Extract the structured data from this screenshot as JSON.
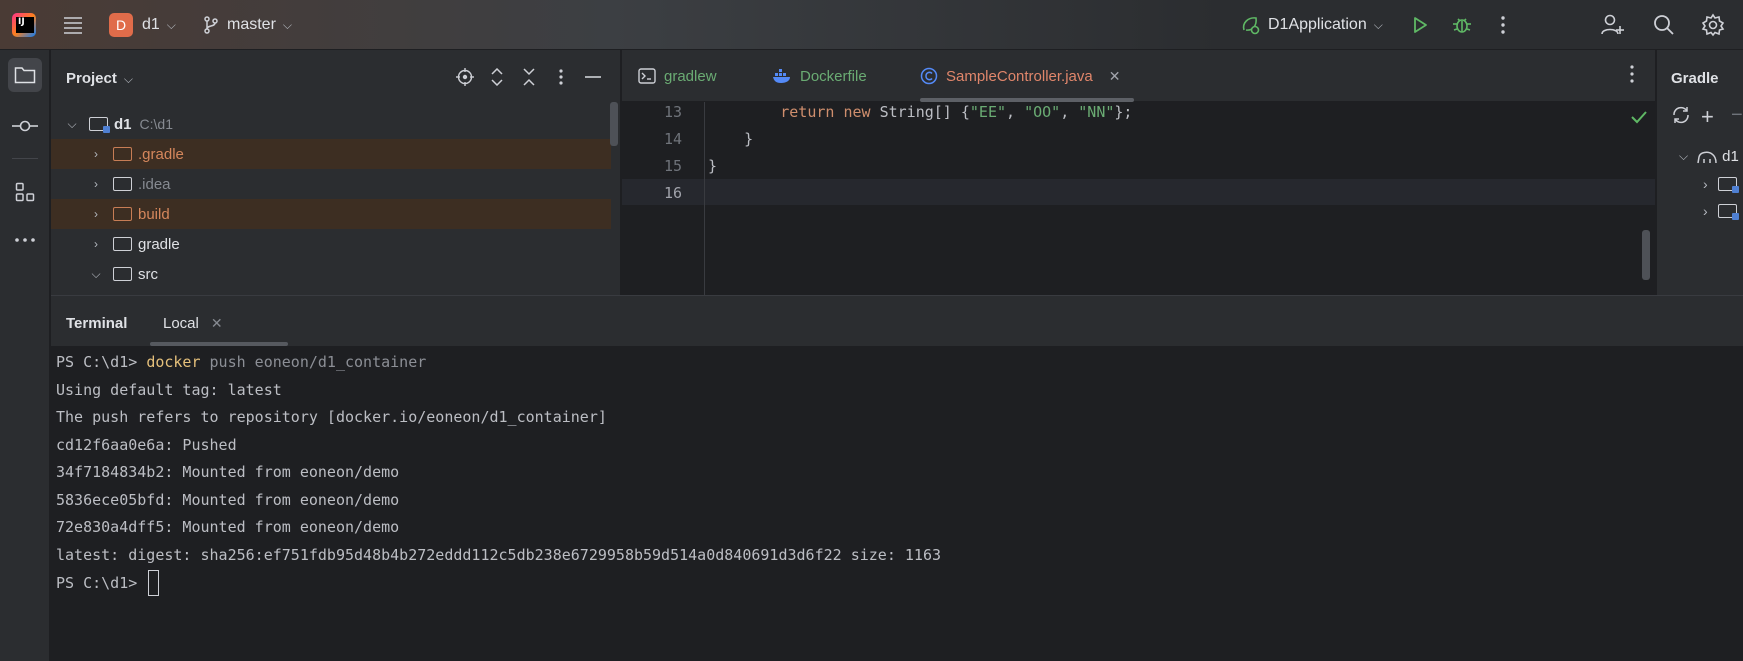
{
  "titlebar": {
    "project_badge": "D",
    "project_name": "d1",
    "branch": "master",
    "run_config": "D1Application"
  },
  "project_panel": {
    "title": "Project",
    "tree": [
      {
        "label": "d1",
        "path": "C:\\d1",
        "expanded": true
      },
      {
        "label": ".gradle",
        "excluded": true
      },
      {
        "label": ".idea"
      },
      {
        "label": "build",
        "excluded": true
      },
      {
        "label": "gradle"
      },
      {
        "label": "src",
        "expanded": true
      }
    ]
  },
  "editor": {
    "tabs": [
      {
        "label": "gradlew",
        "icon": "terminal-file-icon"
      },
      {
        "label": "Dockerfile",
        "icon": "docker-icon"
      },
      {
        "label": "SampleController.java",
        "icon": "java-class-icon",
        "active": true
      }
    ],
    "lines": [
      {
        "no": "13",
        "parts": [
          [
            "",
            "        "
          ],
          [
            "kw",
            "return new "
          ],
          [
            "",
            "String[] {"
          ],
          [
            "str",
            "\"EE\""
          ],
          [
            "",
            ", "
          ],
          [
            "str",
            "\"OO\""
          ],
          [
            "",
            ", "
          ],
          [
            "str",
            "\"NN\""
          ],
          [
            "",
            "};"
          ]
        ]
      },
      {
        "no": "14",
        "parts": [
          [
            "",
            "    }"
          ]
        ]
      },
      {
        "no": "15",
        "parts": [
          [
            "",
            "}"
          ]
        ]
      },
      {
        "no": "16",
        "parts": [
          [
            "",
            ""
          ]
        ]
      }
    ]
  },
  "gradle_panel": {
    "title": "Gradle",
    "root": "d1"
  },
  "terminal": {
    "title": "Terminal",
    "tab": "Local",
    "prompt": "PS C:\\d1> ",
    "command": "docker",
    "command_args": " push eoneon/d1_container",
    "output": [
      "Using default tag: latest",
      "The push refers to repository [docker.io/eoneon/d1_container]",
      "cd12f6aa0e6a: Pushed",
      "34f7184834b2: Mounted from eoneon/demo",
      "5836ece05bfd: Mounted from eoneon/demo",
      "72e830a4dff5: Mounted from eoneon/demo",
      "latest: digest: sha256:ef751fdb95d48b4b272eddd112c5db238e6729958b59d514a0d840691d3d6f22 size: 1163"
    ],
    "final_prompt": "PS C:\\d1> "
  }
}
